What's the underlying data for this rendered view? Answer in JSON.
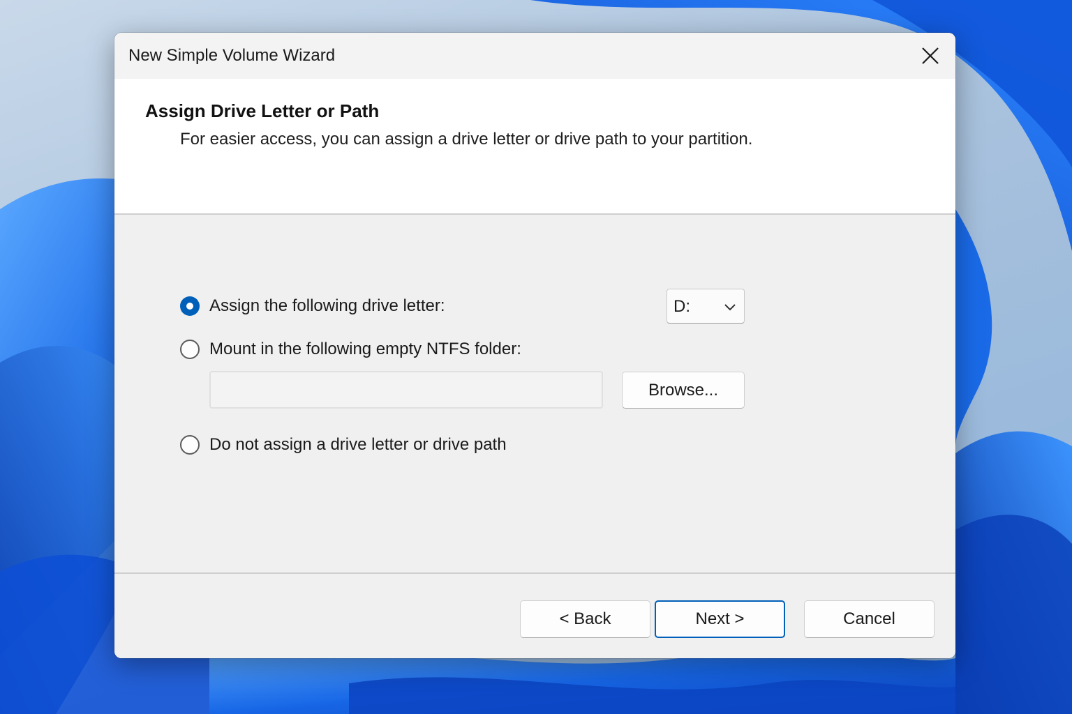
{
  "window": {
    "title": "New Simple Volume Wizard"
  },
  "header": {
    "title": "Assign Drive Letter or Path",
    "subtitle": "For easier access, you can assign a drive letter or drive path to your partition."
  },
  "options": {
    "assign_letter": {
      "label": "Assign the following drive letter:",
      "checked": true
    },
    "mount_folder": {
      "label": "Mount in the following empty NTFS folder:",
      "checked": false
    },
    "no_assign": {
      "label": "Do not assign a drive letter or drive path",
      "checked": false
    }
  },
  "drive_letter": {
    "selected": "D:"
  },
  "folder_path": {
    "value": "",
    "browse_label": "Browse..."
  },
  "footer": {
    "back_label": "< Back",
    "next_label": "Next >",
    "cancel_label": "Cancel"
  },
  "icons": {
    "close": "close-icon",
    "dropdown": "chevron-down-icon"
  },
  "colors": {
    "accent": "#005fb8",
    "header_bg": "#ffffff",
    "body_bg": "#f0f0f0"
  }
}
